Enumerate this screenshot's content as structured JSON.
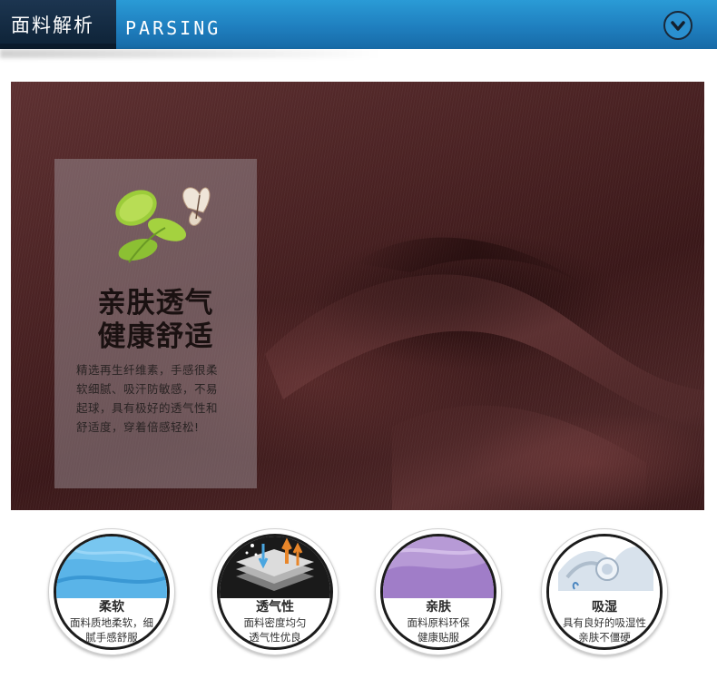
{
  "header": {
    "title_cn": "面料解析",
    "title_en": "PARSING",
    "toggle_icon": "chevron-down-circle-icon"
  },
  "hero": {
    "heading_line1": "亲肤透气",
    "heading_line2": "健康舒适",
    "body_line1": "精选再生纤维素，手感很柔",
    "body_line2": "软细腻、吸汗防敏感，不易",
    "body_line3": "起球，具有极好的透气性和",
    "body_line4": "舒适度，穿着倍感轻松!"
  },
  "features": [
    {
      "title": "柔软",
      "line1": "面料质地柔软，细",
      "line2": "腻手感舒服",
      "icon": "soft-fabric-icon"
    },
    {
      "title": "透气性",
      "line1": "面料密度均匀",
      "line2": "透气性优良",
      "icon": "breathable-layers-icon"
    },
    {
      "title": "亲肤",
      "line1": "面料原料环保",
      "line2": "健康贴服",
      "icon": "skin-friendly-fabric-icon"
    },
    {
      "title": "吸湿",
      "line1": "具有良好的吸湿性",
      "line2": "亲肤不僵硬",
      "icon": "moisture-absorb-icon"
    }
  ],
  "colors": {
    "header_blue": "#1f7fbf",
    "header_dark": "#0d2236",
    "fabric_brown": "#4a2223",
    "feature_label": "#2a2a2a"
  }
}
